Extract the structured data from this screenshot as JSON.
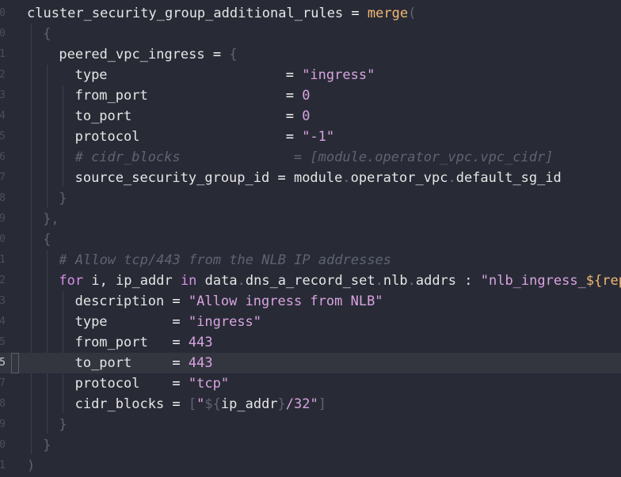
{
  "editor": {
    "current_line_number": "5",
    "lines": [
      {
        "num": "0",
        "indent": 0,
        "tokens": [
          {
            "t": "cluster_security_group_additional_rules",
            "c": "pl"
          },
          {
            "t": " = ",
            "c": "op"
          },
          {
            "t": "merge",
            "c": "fn"
          },
          {
            "t": "(",
            "c": "brk"
          }
        ]
      },
      {
        "num": "0",
        "indent": 1,
        "tokens": [
          {
            "t": "{",
            "c": "brk"
          }
        ]
      },
      {
        "num": "1",
        "indent": 2,
        "tokens": [
          {
            "t": "peered_vpc_ingress",
            "c": "pl"
          },
          {
            "t": " = ",
            "c": "op"
          },
          {
            "t": "{",
            "c": "brk"
          }
        ]
      },
      {
        "num": "2",
        "indent": 3,
        "tokens": [
          {
            "t": "type                     ",
            "c": "pl"
          },
          {
            "t": " = ",
            "c": "op"
          },
          {
            "t": "\"ingress\"",
            "c": "str"
          }
        ]
      },
      {
        "num": "3",
        "indent": 3,
        "tokens": [
          {
            "t": "from_port                ",
            "c": "pl"
          },
          {
            "t": " = ",
            "c": "op"
          },
          {
            "t": "0",
            "c": "num"
          }
        ]
      },
      {
        "num": "4",
        "indent": 3,
        "tokens": [
          {
            "t": "to_port                  ",
            "c": "pl"
          },
          {
            "t": " = ",
            "c": "op"
          },
          {
            "t": "0",
            "c": "num"
          }
        ]
      },
      {
        "num": "5",
        "indent": 3,
        "tokens": [
          {
            "t": "protocol                 ",
            "c": "pl"
          },
          {
            "t": " = ",
            "c": "op"
          },
          {
            "t": "\"-1\"",
            "c": "str"
          }
        ]
      },
      {
        "num": "6",
        "indent": 3,
        "tokens": [
          {
            "t": "# cidr_blocks              = [module.operator_vpc.vpc_cidr]",
            "c": "cm"
          }
        ]
      },
      {
        "num": "7",
        "indent": 3,
        "tokens": [
          {
            "t": "source_security_group_id",
            "c": "pl"
          },
          {
            "t": " = ",
            "c": "op"
          },
          {
            "t": "module",
            "c": "pl"
          },
          {
            "t": ".",
            "c": "dot"
          },
          {
            "t": "operator_vpc",
            "c": "pl"
          },
          {
            "t": ".",
            "c": "dot"
          },
          {
            "t": "default_sg_id",
            "c": "pl"
          }
        ]
      },
      {
        "num": "8",
        "indent": 2,
        "tokens": [
          {
            "t": "}",
            "c": "brk"
          }
        ]
      },
      {
        "num": "9",
        "indent": 1,
        "tokens": [
          {
            "t": "},",
            "c": "brk"
          }
        ]
      },
      {
        "num": "0",
        "indent": 1,
        "tokens": [
          {
            "t": "{",
            "c": "brk"
          }
        ]
      },
      {
        "num": "1",
        "indent": 2,
        "tokens": [
          {
            "t": "# Allow tcp/443 from the NLB IP addresses",
            "c": "cm"
          }
        ]
      },
      {
        "num": "2",
        "indent": 2,
        "tokens": [
          {
            "t": "for",
            "c": "kw"
          },
          {
            "t": " i, ip_addr ",
            "c": "pl"
          },
          {
            "t": "in",
            "c": "kw"
          },
          {
            "t": " data",
            "c": "pl"
          },
          {
            "t": ".",
            "c": "dot"
          },
          {
            "t": "dns_a_record_set",
            "c": "pl"
          },
          {
            "t": ".",
            "c": "dot"
          },
          {
            "t": "nlb",
            "c": "pl"
          },
          {
            "t": ".",
            "c": "dot"
          },
          {
            "t": "addrs : ",
            "c": "pl"
          },
          {
            "t": "\"nlb_ingress_",
            "c": "str"
          },
          {
            "t": "${",
            "c": "interp"
          },
          {
            "t": "repl",
            "c": "fn"
          }
        ]
      },
      {
        "num": "3",
        "indent": 3,
        "tokens": [
          {
            "t": "description",
            "c": "pl"
          },
          {
            "t": " = ",
            "c": "op"
          },
          {
            "t": "\"Allow ingress from NLB\"",
            "c": "str"
          }
        ]
      },
      {
        "num": "4",
        "indent": 3,
        "tokens": [
          {
            "t": "type       ",
            "c": "pl"
          },
          {
            "t": " = ",
            "c": "op"
          },
          {
            "t": "\"ingress\"",
            "c": "str"
          }
        ]
      },
      {
        "num": "5",
        "indent": 3,
        "tokens": [
          {
            "t": "from_port  ",
            "c": "pl"
          },
          {
            "t": " = ",
            "c": "op"
          },
          {
            "t": "443",
            "c": "num"
          }
        ]
      },
      {
        "num": "5",
        "indent": 3,
        "current": true,
        "tokens": [
          {
            "t": "to_port    ",
            "c": "pl"
          },
          {
            "t": " = ",
            "c": "op"
          },
          {
            "t": "443",
            "c": "num"
          }
        ]
      },
      {
        "num": "7",
        "indent": 3,
        "tokens": [
          {
            "t": "protocol   ",
            "c": "pl"
          },
          {
            "t": " = ",
            "c": "op"
          },
          {
            "t": "\"tcp\"",
            "c": "str"
          }
        ]
      },
      {
        "num": "8",
        "indent": 3,
        "tokens": [
          {
            "t": "cidr_blocks",
            "c": "pl"
          },
          {
            "t": " = ",
            "c": "op"
          },
          {
            "t": "[",
            "c": "brk"
          },
          {
            "t": "\"",
            "c": "str"
          },
          {
            "t": "${",
            "c": "brk"
          },
          {
            "t": "ip_addr",
            "c": "pl"
          },
          {
            "t": "}",
            "c": "brk"
          },
          {
            "t": "/32\"",
            "c": "str"
          },
          {
            "t": "]",
            "c": "brk"
          }
        ]
      },
      {
        "num": "9",
        "indent": 2,
        "tokens": [
          {
            "t": "}",
            "c": "brk"
          }
        ]
      },
      {
        "num": "0",
        "indent": 1,
        "tokens": [
          {
            "t": "}",
            "c": "brk"
          }
        ]
      },
      {
        "num": "1",
        "indent": 0,
        "tokens": [
          {
            "t": ")",
            "c": "brk"
          }
        ]
      }
    ]
  },
  "colors": {
    "background": "#282b36",
    "current_line": "#33363f",
    "string": "#d9a3e0",
    "keyword": "#d78ee8",
    "function": "#f3b774",
    "comment": "#5f6372"
  }
}
